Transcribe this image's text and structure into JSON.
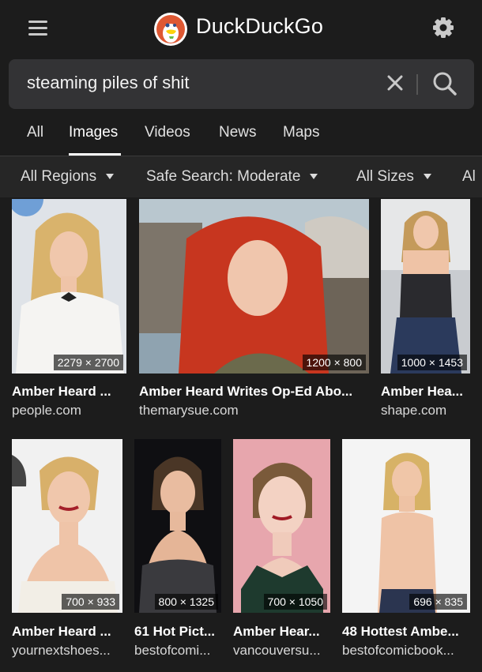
{
  "header": {
    "brand": "DuckDuckGo",
    "menu_icon": "hamburger-icon",
    "settings_icon": "gear-icon"
  },
  "search": {
    "query": "steaming piles of shit",
    "clear_icon": "close-icon",
    "submit_icon": "search-icon"
  },
  "tabs": [
    {
      "label": "All"
    },
    {
      "label": "Images",
      "active": true
    },
    {
      "label": "Videos"
    },
    {
      "label": "News"
    },
    {
      "label": "Maps"
    }
  ],
  "filters": [
    {
      "label": "All Regions"
    },
    {
      "label": "Safe Search: Moderate"
    },
    {
      "label": "All Sizes"
    },
    {
      "label": "Al"
    }
  ],
  "results": [
    {
      "title": "Amber Heard ...",
      "domain": "people.com",
      "dims": "2279 × 2700"
    },
    {
      "title": "Amber Heard Writes Op-Ed Abo...",
      "domain": "themarysue.com",
      "dims": "1200 × 800"
    },
    {
      "title": "Amber Hea...",
      "domain": "shape.com",
      "dims": "1000 × 1453"
    },
    {
      "title": "Amber Heard ...",
      "domain": "yournextshoes...",
      "dims": "700 × 933"
    },
    {
      "title": "61 Hot Pict...",
      "domain": "bestofcomi...",
      "dims": "800 × 1325"
    },
    {
      "title": "Amber Hear...",
      "domain": "vancouversu...",
      "dims": "700 × 1050"
    },
    {
      "title": "48 Hottest Ambe...",
      "domain": "bestofcomicbook...",
      "dims": "696 × 835"
    }
  ],
  "colors": {
    "background": "#1c1c1c",
    "search_box": "#333335",
    "filter_bar": "#262626"
  }
}
